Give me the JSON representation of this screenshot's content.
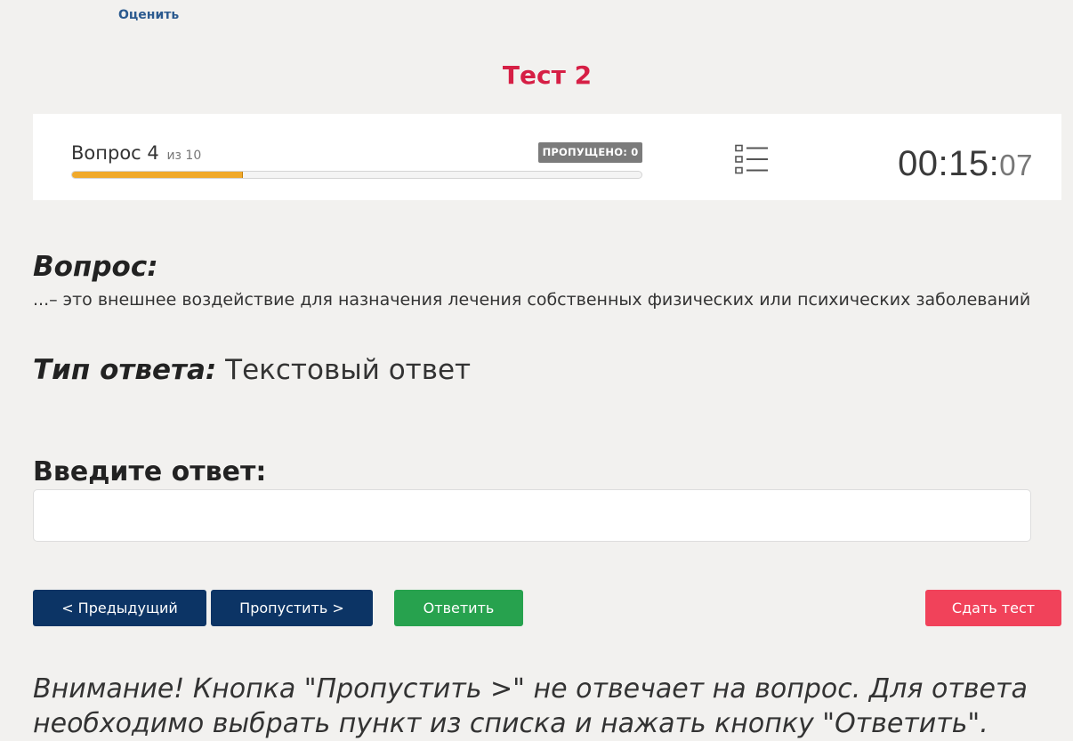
{
  "header": {
    "rate_link": "Оценить",
    "test_title": "Тест 2"
  },
  "status": {
    "question_label": "Вопрос 4",
    "question_of": "из 10",
    "progress_fraction": 0.3,
    "skipped_badge": "ПРОПУЩЕНО: 0",
    "list_icon": "list-icon",
    "timer_main": "00:15:",
    "timer_seconds": "07",
    "progress_color": "#f0a92b"
  },
  "question": {
    "heading": "Вопрос:",
    "text": "...– это внешнее воздействие для назначения лечения собственных физических или психических заболеваний",
    "answer_type_label": "Тип ответа:",
    "answer_type_value": "Текстовый ответ"
  },
  "answer": {
    "label": "Введите ответ:",
    "value": "",
    "placeholder": ""
  },
  "buttons": {
    "prev": "< Предыдущий",
    "skip": "Пропустить >",
    "answer": "Ответить",
    "submit": "Сдать тест"
  },
  "colors": {
    "title": "#d61f45",
    "nav_button": "#0c3465",
    "answer_button": "#27a24e",
    "submit_button": "#f1425a",
    "badge": "#7b7b7b"
  },
  "warning": "Внимание! Кнопка \"Пропустить >\" не отвечает на вопрос. Для ответа необходимо выбрать пункт из списка и нажать кнопку \"Ответить\"."
}
